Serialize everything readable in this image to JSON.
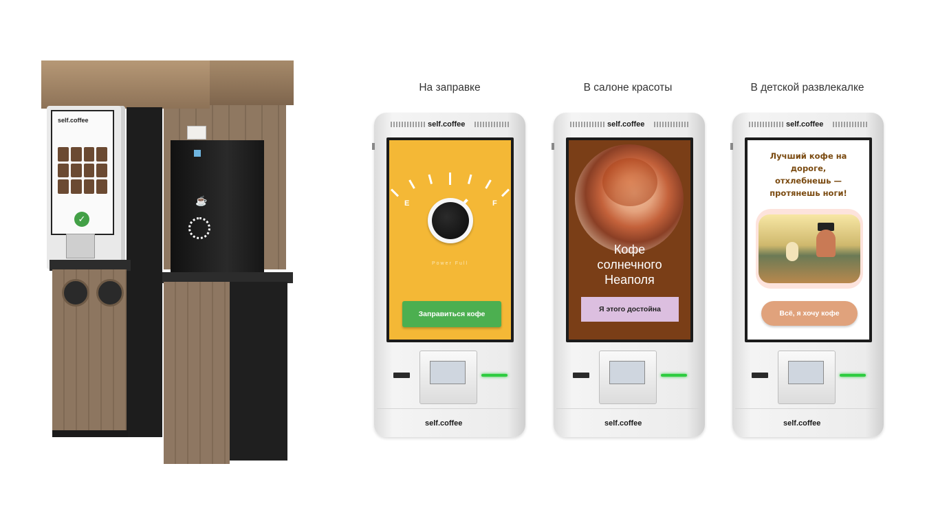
{
  "left_kiosk": {
    "logo": "self.coffee"
  },
  "captions": [
    "На заправке",
    "В салоне красоты",
    "В детской развлекалке"
  ],
  "kiosks": [
    {
      "logo": "self.coffee",
      "gauge_empty": "E",
      "gauge_full": "F",
      "tagline": "Power Full",
      "button_label": "Заправиться кофе",
      "button_color": "#4caf50",
      "screen_bg": "#f4b836"
    },
    {
      "logo": "self.coffee",
      "title_lines": [
        "Кофе",
        "солнечного",
        "Неаполя"
      ],
      "button_label": "Я этого достойна",
      "button_color": "#dcbfe0",
      "screen_bg": "#7a3e17"
    },
    {
      "logo": "self.coffee",
      "title_lines": [
        "Лучший кофе на",
        "дороге,",
        "отхлебнешь —",
        "протянешь ноги!"
      ],
      "button_label": "Всё, я хочу кофе",
      "button_color": "#e0a27c",
      "screen_bg": "#ffffff"
    }
  ]
}
